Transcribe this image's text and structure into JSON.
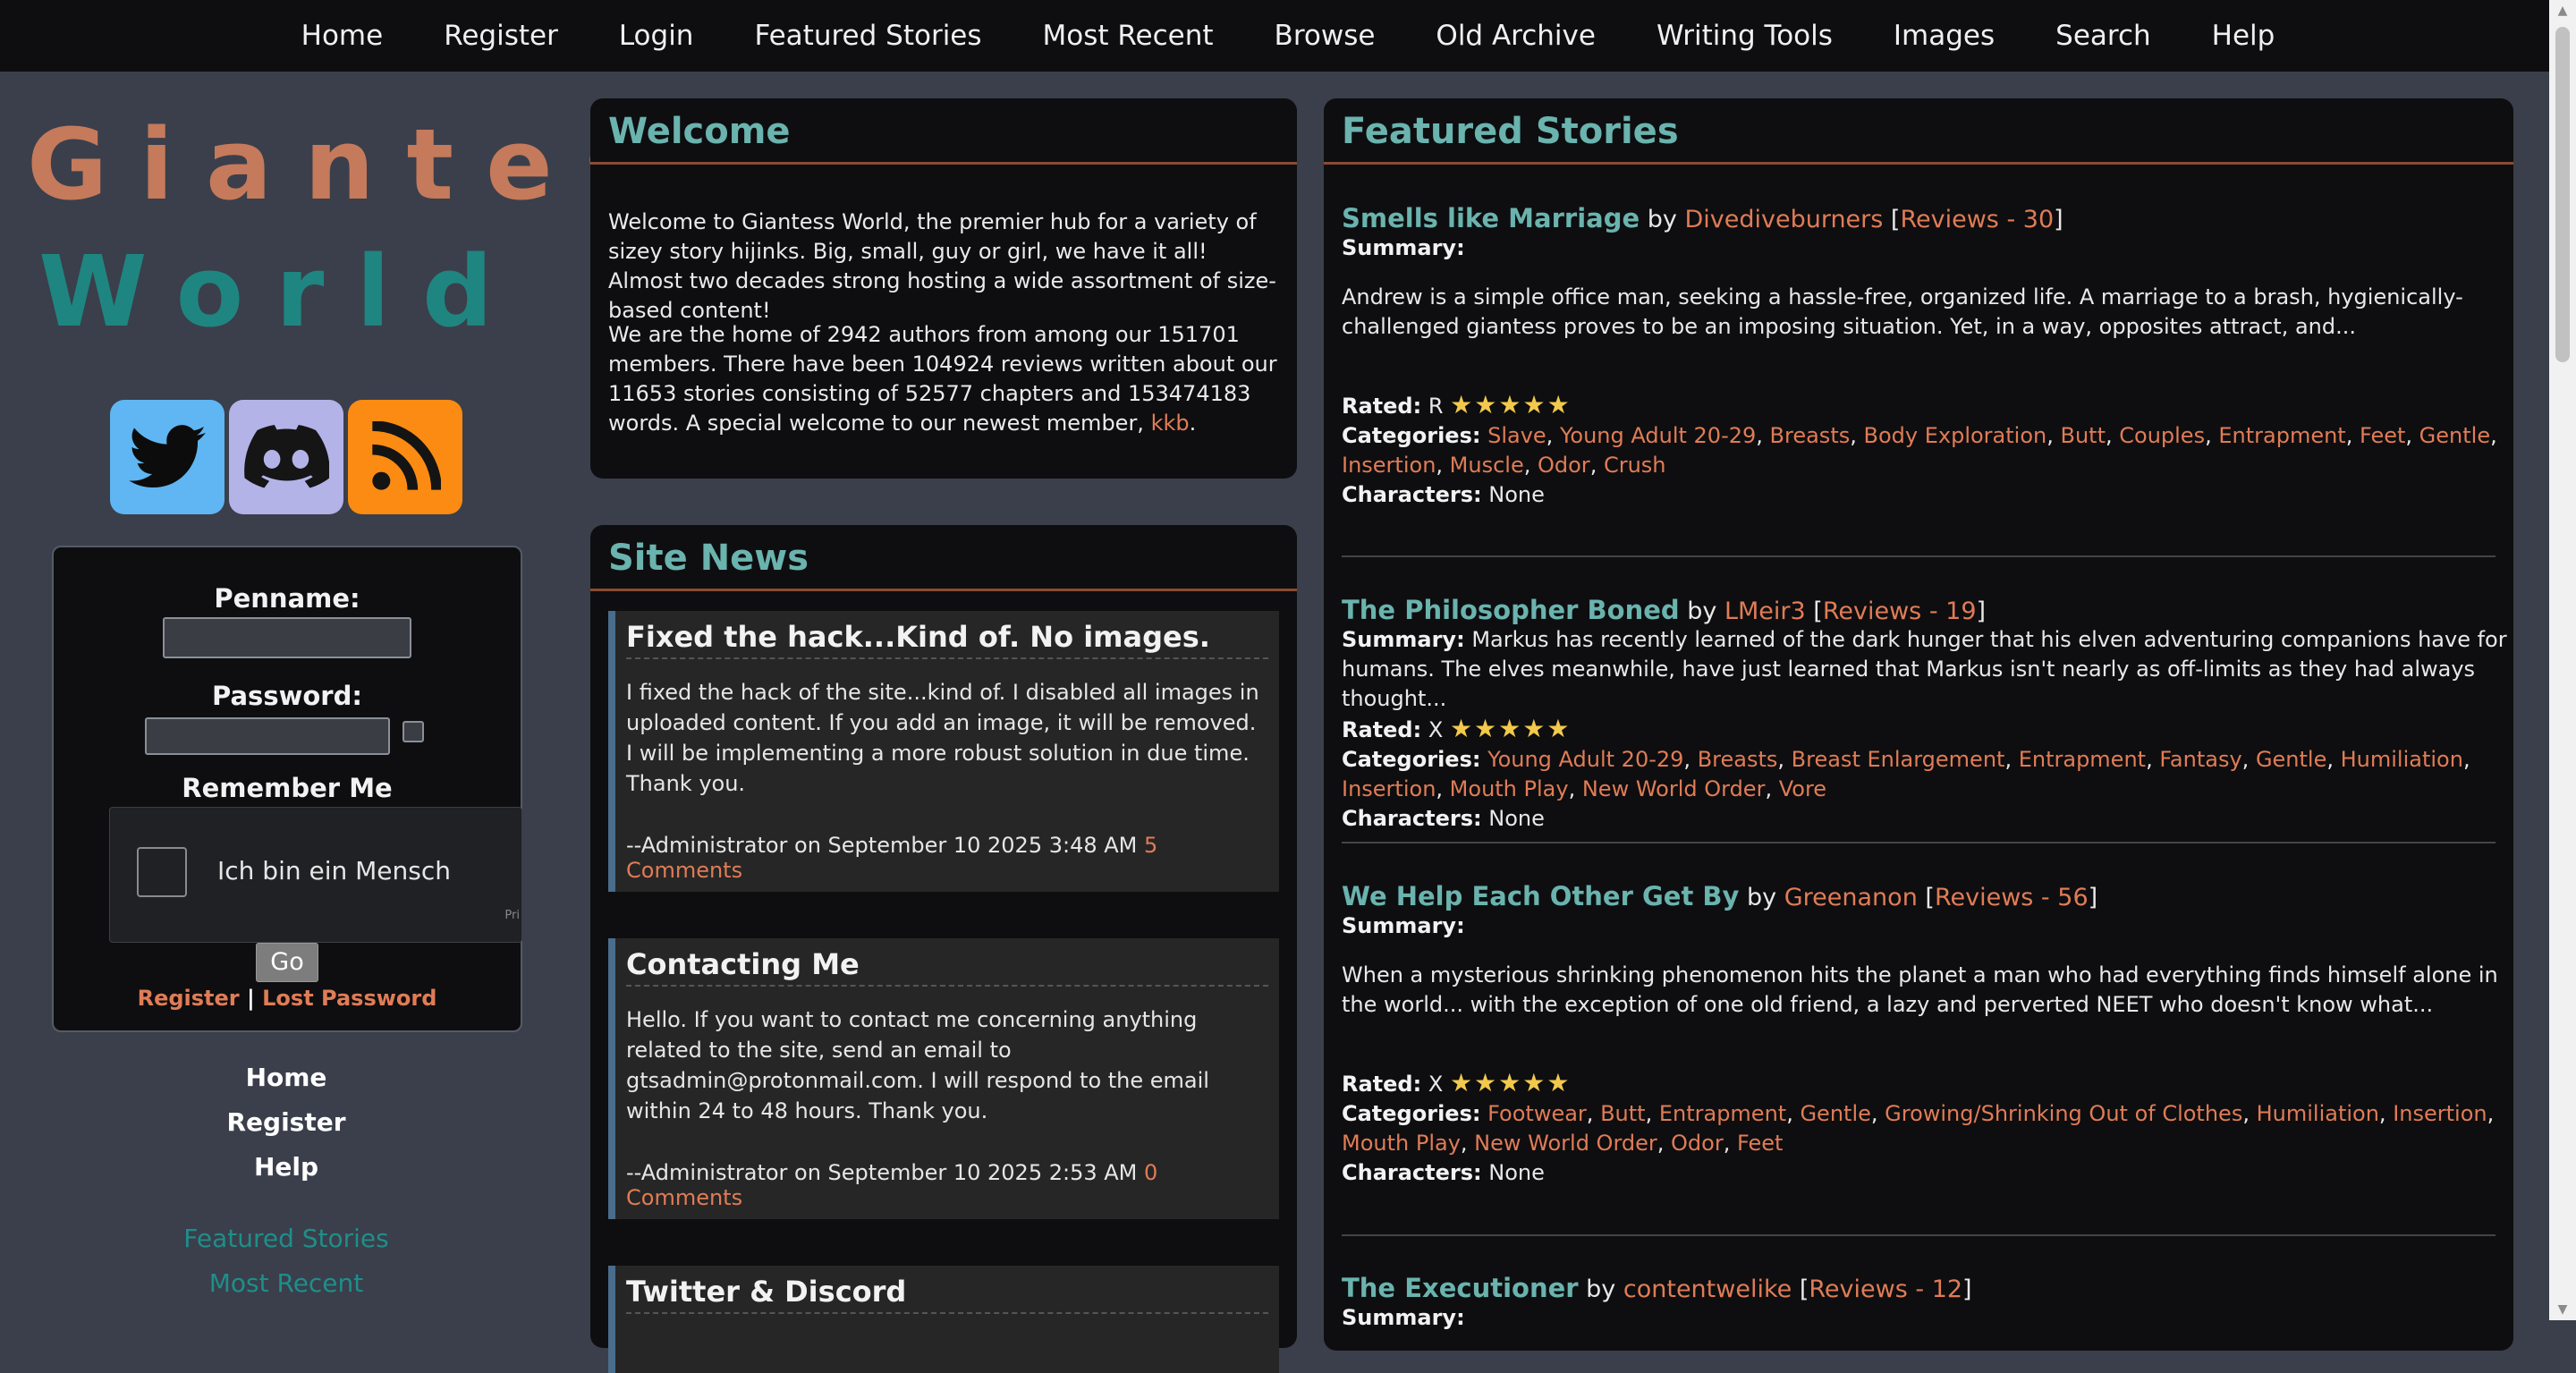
{
  "topnav": [
    "Home",
    "Register",
    "Login",
    "Featured Stories",
    "Most Recent",
    "Browse",
    "Old Archive",
    "Writing Tools",
    "Images",
    "Search",
    "Help"
  ],
  "logo": {
    "line1": "Giantess",
    "line2": "World"
  },
  "social": [
    "twitter-icon",
    "discord-icon",
    "rss-icon"
  ],
  "login": {
    "penname_label": "Penname:",
    "password_label": "Password:",
    "remember_label": "Remember Me",
    "captcha_text": "Ich bin ein Mensch",
    "captcha_small": "Pri",
    "go_label": "Go",
    "register_link": "Register",
    "separator": "|",
    "lost_password_link": "Lost Password"
  },
  "sidebar": {
    "links": [
      "Home",
      "Register",
      "Help"
    ],
    "links2": [
      "Featured Stories",
      "Most Recent"
    ]
  },
  "welcome": {
    "title": "Welcome",
    "p1": "Welcome to Giantess World, the premier hub for a variety of sizey story hijinks. Big, small, guy or girl, we have it all! Almost two decades strong hosting a wide assortment of size-based content!",
    "p2": "We are the home of 2942 authors from among our 151701 members. There have been 104924 reviews written about our 11653 stories consisting of 52577 chapters and 153474183 words. A special welcome to our newest member,",
    "newest_member": "kkb",
    "p2_end": "."
  },
  "news": {
    "title": "Site News",
    "items": [
      {
        "title": "Fixed the hack...Kind of. No images.",
        "body": "I fixed the hack of the site...kind of. I disabled all images in uploaded content. If you add an image, it will be removed. I will be implementing a more robust solution in due time. Thank you.",
        "footer": "--Administrator on September 10 2025 3:48 AM",
        "comments": "5 Comments"
      },
      {
        "title": "Contacting Me",
        "body": "Hello. If you want to contact me concerning anything related to the site, send an email to gtsadmin@protonmail.com. I will respond to the email within 24 to 48 hours. Thank you.",
        "footer": "--Administrator on September 10 2025 2:53 AM",
        "comments": "0 Comments"
      },
      {
        "title": "Twitter & Discord"
      }
    ]
  },
  "featured": {
    "title": "Featured Stories",
    "labels": {
      "by": "by",
      "reviews": "Reviews",
      "summary": "Summary:",
      "rated": "Rated:",
      "categories": "Categories:",
      "characters": "Characters:"
    },
    "stories": [
      {
        "title": "Smells like Marriage",
        "author": "Divediveburners",
        "reviews": "30",
        "summary": "Andrew is a simple office man, seeking a hassle-free, organized life. A marriage to a brash, hygienically-challenged giantess proves to be an imposing situation. Yet, in a way, opposites attract, and...",
        "rating": "R",
        "stars": 5,
        "categories": "Slave, Young Adult 20-29, Breasts, Body Exploration, Butt, Couples, Entrapment, Feet, Gentle, Insertion, Muscle, Odor, Crush",
        "characters": "None"
      },
      {
        "title": "The Philosopher Boned",
        "author": "LMeir3",
        "reviews": "19",
        "summary": "Markus has recently learned of the dark hunger that his elven adventuring companions have for humans. The elves meanwhile, have just learned that Markus isn't nearly as off-limits as they had always thought...",
        "rating": "X",
        "stars": 5,
        "categories": "Young Adult 20-29, Breasts, Breast Enlargement, Entrapment, Fantasy, Gentle, Humiliation, Insertion, Mouth Play, New World Order, Vore",
        "characters": "None"
      },
      {
        "title": "We Help Each Other Get By",
        "author": "Greenanon",
        "reviews": "56",
        "summary": "When a mysterious shrinking phenomenon hits the planet a man who had everything finds himself alone in the world... with the exception of one old friend, a lazy and perverted NEET who doesn't know what...",
        "rating": "X",
        "stars": 5,
        "categories": "Footwear, Butt, Entrapment, Gentle, Growing/Shrinking Out of Clothes, Humiliation, Insertion, Mouth Play, New World Order, Odor, Feet",
        "characters": "None"
      },
      {
        "title": "The Executioner",
        "author": "contentwelike",
        "reviews": "12"
      }
    ]
  },
  "colors": {
    "accent_teal": "#6ab3ae",
    "link_orange": "#e07c56",
    "logo_orange": "#c57a5b",
    "logo_teal": "#1f8580"
  }
}
